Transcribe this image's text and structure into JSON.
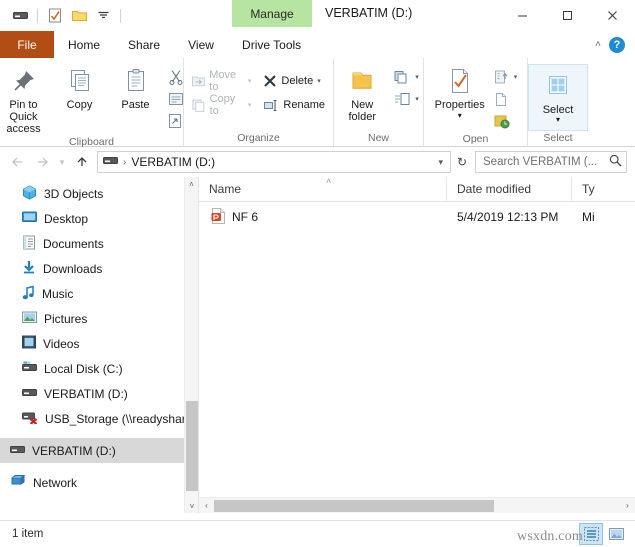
{
  "window": {
    "title": "VERBATIM (D:)",
    "minimize_label": "—",
    "maximize_label": "☐",
    "close_label": "✕"
  },
  "quick_access_toolbar": {
    "items": [
      {
        "name": "drive-icon",
        "label": ""
      },
      {
        "name": "properties-check-icon",
        "label": ""
      },
      {
        "name": "new-folder-icon",
        "label": ""
      },
      {
        "name": "customize-dropdown-icon",
        "label": "▾"
      }
    ]
  },
  "ribbon": {
    "contextual_tab_title": "Manage",
    "tabs": [
      {
        "label": "File",
        "state": "file"
      },
      {
        "label": "Home",
        "state": "active"
      },
      {
        "label": "Share",
        "state": "normal"
      },
      {
        "label": "View",
        "state": "normal"
      },
      {
        "label": "Drive Tools",
        "state": "contextual"
      }
    ],
    "collapse_label": "˄",
    "help_label": "?",
    "groups": [
      {
        "label": "Clipboard",
        "big_buttons": [
          {
            "name": "pin-to-quick-access-button",
            "label": "Pin to Quick\naccess",
            "line1": "Pin to Quick",
            "line2": "access"
          },
          {
            "name": "copy-button",
            "label": "Copy",
            "line1": "Copy",
            "line2": ""
          },
          {
            "name": "paste-button",
            "label": "Paste",
            "line1": "Paste",
            "line2": ""
          }
        ],
        "small_buttons": [
          {
            "name": "cut-button",
            "label": ""
          },
          {
            "name": "copy-path-button",
            "label": ""
          },
          {
            "name": "paste-shortcut-button",
            "label": ""
          }
        ]
      },
      {
        "label": "Organize",
        "small_buttons": [
          {
            "name": "move-to-button",
            "label": "Move to",
            "disabled": true,
            "caret": "▾"
          },
          {
            "name": "copy-to-button",
            "label": "Copy to",
            "disabled": true,
            "caret": "▾"
          },
          {
            "name": "delete-button",
            "label": "Delete",
            "disabled": false,
            "caret": "▾"
          },
          {
            "name": "rename-button",
            "label": "Rename",
            "disabled": false,
            "caret": ""
          }
        ]
      },
      {
        "label": "New",
        "big_buttons": [
          {
            "name": "new-folder-button",
            "line1": "New",
            "line2": "folder"
          }
        ],
        "small_buttons": [
          {
            "name": "new-item-button",
            "label": "",
            "caret": "▾"
          },
          {
            "name": "easy-access-button",
            "label": "",
            "caret": "▾"
          }
        ]
      },
      {
        "label": "Open",
        "big_buttons": [
          {
            "name": "properties-button",
            "line1": "Properties",
            "line2": "▾"
          }
        ],
        "small_buttons": [
          {
            "name": "open-with-button",
            "label": "",
            "caret": "▾"
          },
          {
            "name": "edit-button",
            "label": "",
            "caret": ""
          },
          {
            "name": "history-button",
            "label": "",
            "caret": ""
          }
        ]
      },
      {
        "label": "Select",
        "big_buttons": [
          {
            "name": "select-button",
            "line1": "Select",
            "line2": "▾"
          }
        ]
      }
    ]
  },
  "address_bar": {
    "back_label": "←",
    "forward_label": "→",
    "recent_label": "▾",
    "up_label": "↑",
    "breadcrumb": [
      {
        "name": "drive-icon",
        "label": ""
      },
      {
        "name": "breadcrumb-verbatim",
        "label": "VERBATIM (D:)"
      }
    ],
    "breadcrumb_separator": "›",
    "dropdown_caret": "▾",
    "refresh_label": "↻",
    "search_placeholder": "Search VERBATIM (...",
    "search_value": "",
    "search_icon": "⌕"
  },
  "navigation_pane": {
    "items": [
      {
        "name": "sidebar-item-3d-objects",
        "label": "3D Objects",
        "icon": "3d-objects-icon",
        "selected": false
      },
      {
        "name": "sidebar-item-desktop",
        "label": "Desktop",
        "icon": "desktop-icon",
        "selected": false
      },
      {
        "name": "sidebar-item-documents",
        "label": "Documents",
        "icon": "documents-icon",
        "selected": false
      },
      {
        "name": "sidebar-item-downloads",
        "label": "Downloads",
        "icon": "downloads-icon",
        "selected": false
      },
      {
        "name": "sidebar-item-music",
        "label": "Music",
        "icon": "music-icon",
        "selected": false
      },
      {
        "name": "sidebar-item-pictures",
        "label": "Pictures",
        "icon": "pictures-icon",
        "selected": false
      },
      {
        "name": "sidebar-item-videos",
        "label": "Videos",
        "icon": "videos-icon",
        "selected": false
      },
      {
        "name": "sidebar-item-local-disk-c",
        "label": "Local Disk (C:)",
        "icon": "hard-drive-icon",
        "selected": false
      },
      {
        "name": "sidebar-item-verbatim-d",
        "label": "VERBATIM (D:)",
        "icon": "removable-drive-icon",
        "selected": false
      },
      {
        "name": "sidebar-item-usb-storage",
        "label": "USB_Storage (\\\\readyshare)",
        "icon": "disconnected-network-drive-icon",
        "selected": false
      }
    ],
    "root_items": [
      {
        "name": "sidebar-item-verbatim-d-root",
        "label": "VERBATIM (D:)",
        "icon": "removable-drive-icon",
        "selected": true
      },
      {
        "name": "sidebar-item-network",
        "label": "Network",
        "icon": "network-icon",
        "selected": false
      }
    ],
    "scroll_up_label": "˄",
    "scroll_down_label": "˅"
  },
  "file_list": {
    "columns": [
      {
        "name": "column-header-name",
        "label": "Name",
        "sorted": true
      },
      {
        "name": "column-header-date-modified",
        "label": "Date modified",
        "sorted": false
      },
      {
        "name": "column-header-type",
        "label": "Ty",
        "sorted": false
      }
    ],
    "sort_indicator": "˄",
    "rows": [
      {
        "name": "NF 6",
        "date_modified": "5/4/2019 12:13 PM",
        "type": "Mi",
        "icon": "powerpoint-file-icon"
      }
    ],
    "hscroll_left_label": "‹",
    "hscroll_right_label": "›"
  },
  "status_bar": {
    "item_count": "1 item",
    "view_buttons": [
      {
        "name": "details-view-button",
        "active": true
      },
      {
        "name": "large-icons-view-button",
        "active": false
      }
    ]
  },
  "watermark": {
    "text": "wsxdn.com"
  },
  "colors": {
    "file_tab": "#b24d16",
    "contextual_tab": "#b5e5a0",
    "selection": "#d8d8d8",
    "help_blue": "#1e8bd4",
    "powerpoint_orange": "#d24726"
  }
}
